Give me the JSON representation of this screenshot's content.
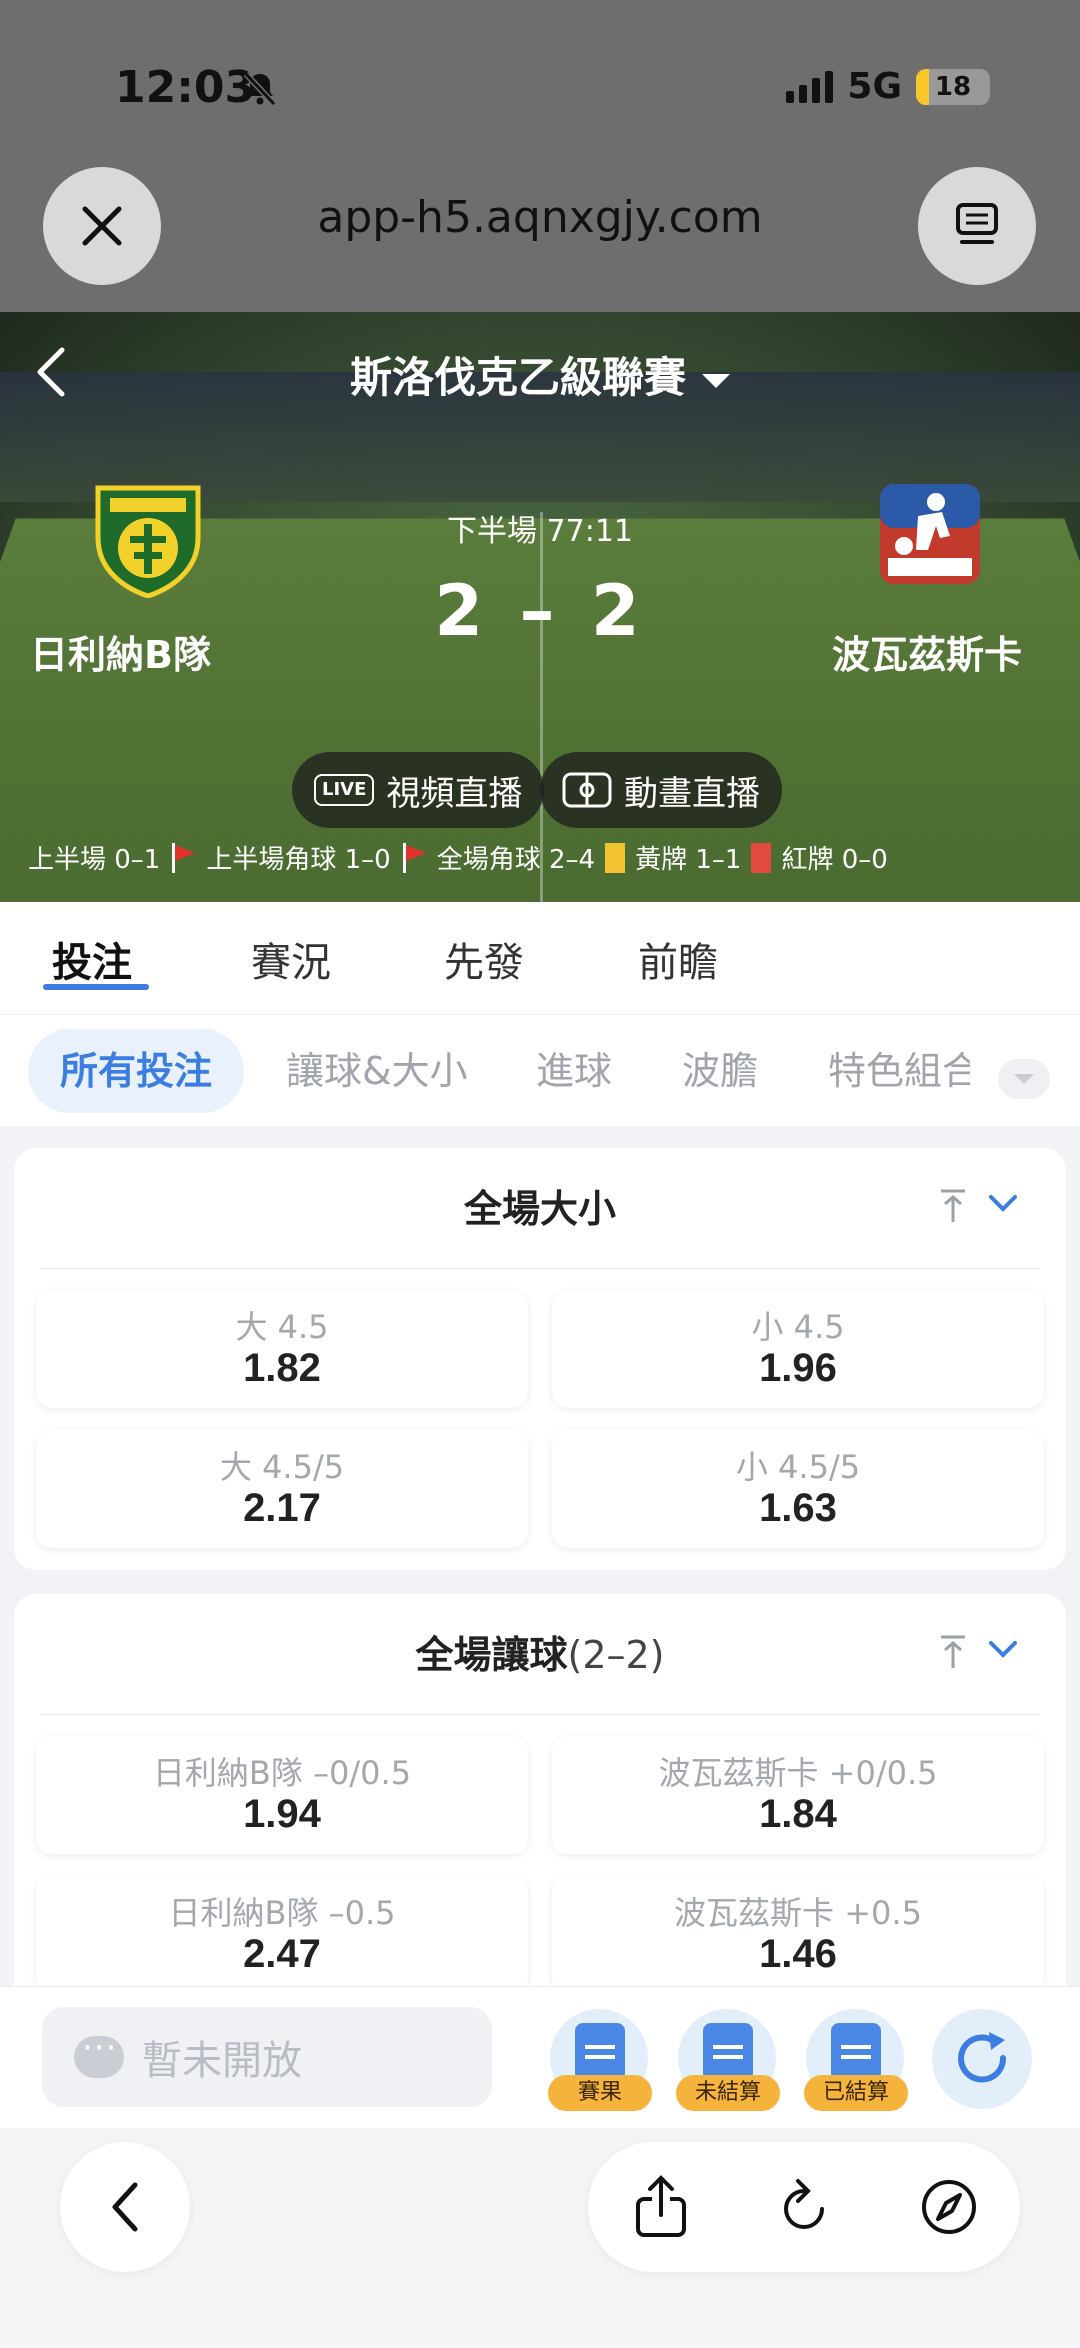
{
  "status_bar": {
    "time": "12:03",
    "network": "5G",
    "battery": "18",
    "battery_level_percent": 18
  },
  "browser": {
    "url": "app-h5.aqnxgjy.com"
  },
  "match": {
    "league": "斯洛伐克乙級聯賽",
    "home_team": "日利納B隊",
    "away_team": "波瓦茲斯卡",
    "period": "下半場 77:11",
    "score": "2 – 2",
    "video_live": "視頻直播",
    "anim_live": "動畫直播",
    "live_badge": "LIVE",
    "stats": {
      "half_time": "上半場 0–1",
      "half_corners": "上半場角球 1–0",
      "full_corners": "全場角球 2–4",
      "yellow": "黃牌 1–1",
      "red": "紅牌 0–0"
    }
  },
  "tabs": [
    "投注",
    "賽況",
    "先發",
    "前瞻"
  ],
  "subtabs": [
    "所有投注",
    "讓球&大小",
    "進球",
    "波膽",
    "特色組合"
  ],
  "markets": [
    {
      "title": "全場大小",
      "subtitle": "",
      "odds": [
        {
          "label": "大 4.5",
          "value": "1.82"
        },
        {
          "label": "小 4.5",
          "value": "1.96"
        },
        {
          "label": "大 4.5/5",
          "value": "2.17"
        },
        {
          "label": "小 4.5/5",
          "value": "1.63"
        }
      ]
    },
    {
      "title": "全場讓球",
      "subtitle": "(2–2)",
      "odds": [
        {
          "label": "日利納B隊 –0/0.5",
          "value": "1.94"
        },
        {
          "label": "波瓦茲斯卡 +0/0.5",
          "value": "1.84"
        },
        {
          "label": "日利納B隊 –0.5",
          "value": "2.47"
        },
        {
          "label": "波瓦茲斯卡 +0.5",
          "value": "1.46"
        }
      ]
    }
  ],
  "betbar": {
    "chat_placeholder": "暫未開放",
    "results": "賽果",
    "unsettled": "未結算",
    "settled": "已結算"
  },
  "colors": {
    "accent": "#3b7de0",
    "tag": "#f5b33b",
    "yellow_card": "#f2c230",
    "red_card": "#e34a3f"
  }
}
